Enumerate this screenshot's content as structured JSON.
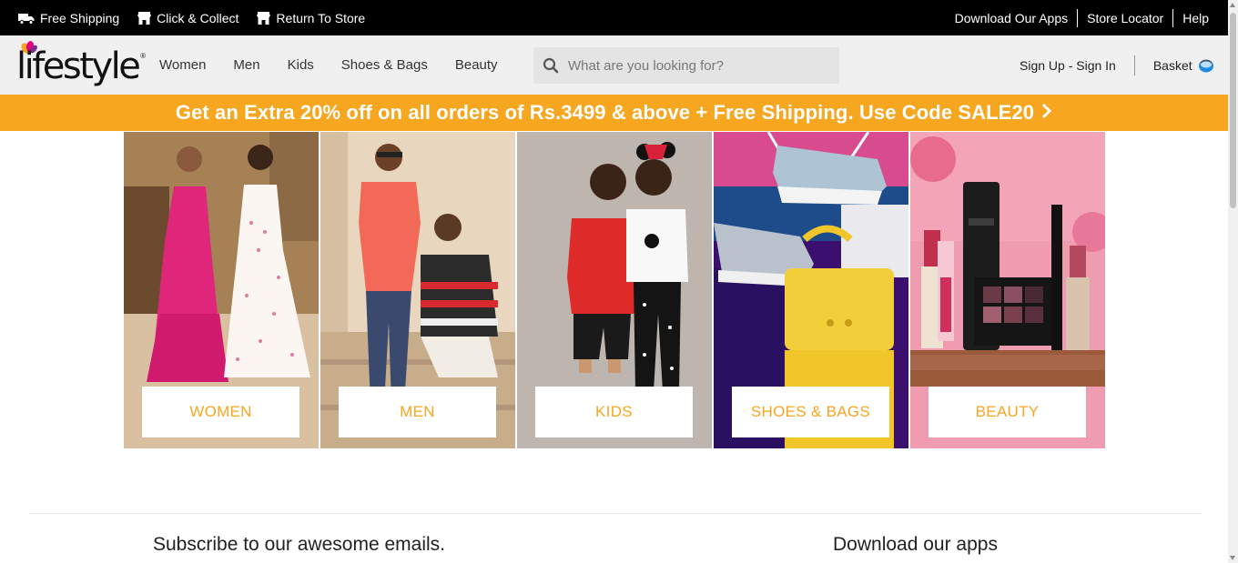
{
  "topbar": {
    "left_items": [
      {
        "label": "Free Shipping",
        "icon": "truck-icon"
      },
      {
        "label": "Click & Collect",
        "icon": "store-icon"
      },
      {
        "label": "Return To Store",
        "icon": "store-icon"
      }
    ],
    "right_links": [
      "Download Our Apps",
      "Store Locator",
      "Help"
    ]
  },
  "header": {
    "logo_text": "lifestyle",
    "logo_reg": "®",
    "nav": [
      "Women",
      "Men",
      "Kids",
      "Shoes & Bags",
      "Beauty"
    ],
    "search_placeholder": "What are you looking for?",
    "account_label": "Sign Up - Sign In",
    "basket_label": "Basket"
  },
  "promo": {
    "text": "Get an Extra 20% off on all orders of Rs.3499 & above + Free Shipping. Use Code SALE20",
    "chevron": "›"
  },
  "categories": [
    {
      "label": "WOMEN"
    },
    {
      "label": "MEN"
    },
    {
      "label": "KIDS"
    },
    {
      "label": "SHOES & BAGS"
    },
    {
      "label": "BEAUTY"
    }
  ],
  "footer": {
    "subscribe_title": "Subscribe to our awesome emails.",
    "apps_title": "Download our apps"
  },
  "colors": {
    "accent": "#f7a620",
    "topbar_bg": "#000000",
    "header_bg": "#f0f0f0"
  }
}
